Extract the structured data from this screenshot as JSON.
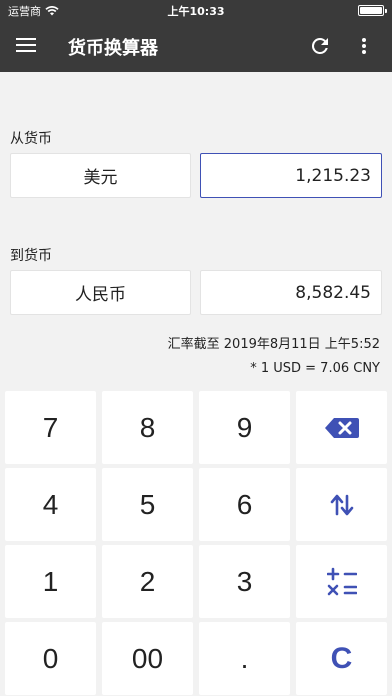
{
  "status_bar": {
    "carrier": "运营商",
    "time": "上午10:33"
  },
  "app_bar": {
    "title": "货币换算器"
  },
  "from": {
    "label": "从货币",
    "currency": "美元",
    "amount": "1,215.23"
  },
  "to": {
    "label": "到货币",
    "currency": "人民币",
    "amount": "8,582.45"
  },
  "rate_info": {
    "timestamp": "汇率截至 2019年8月11日 上午5:52",
    "rate": "* 1 USD = 7.06 CNY"
  },
  "keypad": {
    "k7": "7",
    "k8": "8",
    "k9": "9",
    "k4": "4",
    "k5": "5",
    "k6": "6",
    "k1": "1",
    "k2": "2",
    "k3": "3",
    "k0": "0",
    "k00": "00",
    "kdot": ".",
    "kclear": "C"
  },
  "colors": {
    "accent": "#3f51b5",
    "app_bar": "#3a3a3a",
    "background": "#f2f2f2"
  },
  "icons": {
    "menu": "menu-icon",
    "refresh": "refresh-icon",
    "more": "more-vert-icon",
    "backspace": "backspace-icon",
    "swap": "swap-vert-icon",
    "calculator": "calculator-icon",
    "wifi": "wifi-icon",
    "battery": "battery-icon"
  }
}
